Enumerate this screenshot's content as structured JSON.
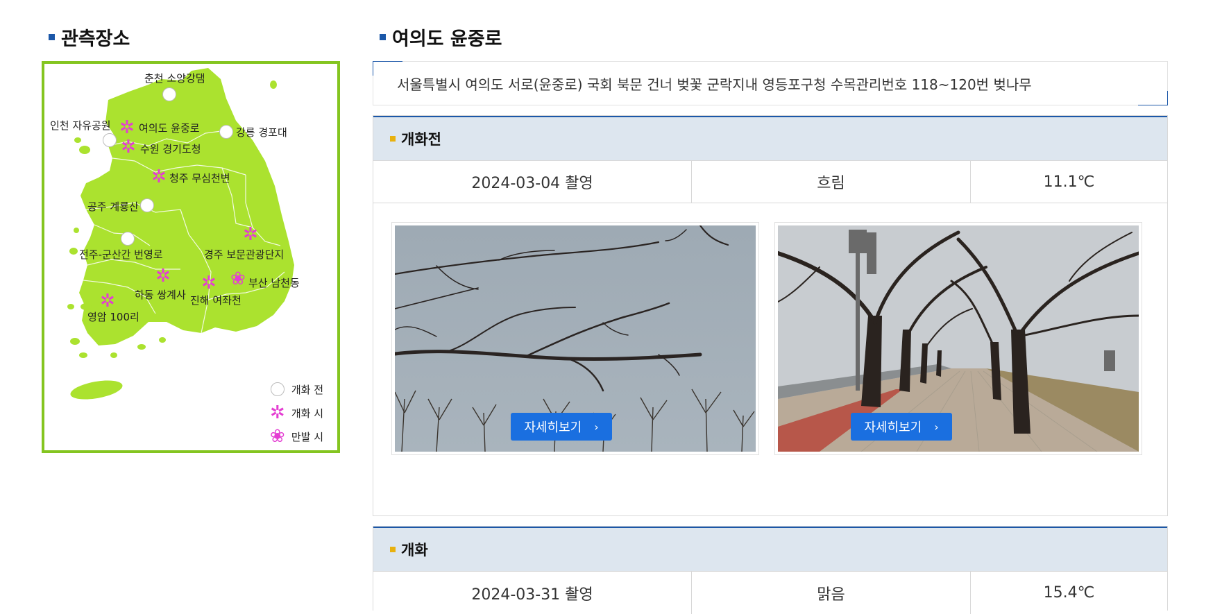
{
  "left": {
    "title": "관측장소",
    "sites": {
      "chuncheon": "춘천 소양강댐",
      "incheon": "인천 자유공원",
      "yeouido": "여의도 윤중로",
      "gangneung": "강릉 경포대",
      "suwon": "수원 경기도청",
      "cheongju": "청주 무심천변",
      "gongju": "공주 계룡산",
      "jeonju": "전주-군산간 번영로",
      "gyeongju": "경주 보문관광단지",
      "busan": "부산 남천동",
      "hadong": "하동 쌍계사",
      "jinhae": "진해 여좌천",
      "yeongam": "영암 100리"
    },
    "legend": {
      "before": "개화 전",
      "blooming": "개화 시",
      "full": "만발 시"
    },
    "colors": {
      "land": "#abe22f",
      "border": "#84c520",
      "flower": "#e43dd2"
    }
  },
  "right": {
    "title": "여의도 윤중로",
    "address": "서울특별시 여의도 서로(윤중로) 국회 북문 건너 벚꽃 군락지내 영등포구청 수목관리번호 118~120번 벚나무",
    "sections": [
      {
        "heading": "개화전",
        "date": "2024-03-04 촬영",
        "weather": "흐림",
        "temp": "11.1℃",
        "button_label": "자세히보기",
        "button_chev": "›"
      },
      {
        "heading": "개화",
        "date": "2024-03-31 촬영",
        "weather": "맑음",
        "temp": "15.4℃"
      }
    ]
  }
}
